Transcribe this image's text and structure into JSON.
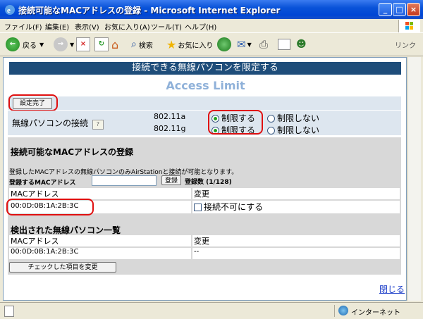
{
  "window": {
    "title": "接続可能なMACアドレスの登録 - Microsoft Internet Explorer"
  },
  "menu": [
    "ファイル(F)",
    "編集(E)",
    "表示(V)",
    "お気に入り(A)",
    "ツール(T)",
    "ヘルプ(H)"
  ],
  "toolbar": {
    "back": "戻る",
    "search": "検索",
    "favorites": "お気に入り",
    "links": "リンク"
  },
  "page": {
    "banner": "接続できる無線パソコンを限定する",
    "subtitle": "Access Limit",
    "apply_button": "設定完了",
    "wireless_label": "無線パソコンの接続",
    "bands": [
      {
        "name": "802.11a",
        "limit": "制限する",
        "nolimit": "制限しない",
        "selected": "limit"
      },
      {
        "name": "802.11g",
        "limit": "制限する",
        "nolimit": "制限しない",
        "selected": "limit"
      }
    ],
    "register_title": "接続可能なMACアドレスの登録",
    "register_note": "登録したMACアドレスの無線パソコンのみAirStationと接続が可能となります。",
    "register_label": "登録するMACアドレス",
    "register_button": "登録",
    "register_count": "登録数 (1/128)",
    "registered_table": {
      "headers": [
        "MACアドレス",
        "変更"
      ],
      "rows": [
        {
          "mac": "00:0D:0B:1A:2B:3C",
          "action": "接続不可にする"
        }
      ]
    },
    "detected_title": "検出された無線パソコン一覧",
    "detected_table": {
      "headers": [
        "MACアドレス",
        "変更"
      ],
      "rows": [
        {
          "mac": "00:0D:0B:1A:2B:3C",
          "action": "--"
        }
      ]
    },
    "change_button": "チェックした項目を変更",
    "close_link": "閉じる"
  },
  "status": {
    "zone": "インターネット"
  },
  "colors": {
    "banner": "#1E4D7A",
    "highlight": "#E01010",
    "subtitle": "#8FB1D9"
  }
}
